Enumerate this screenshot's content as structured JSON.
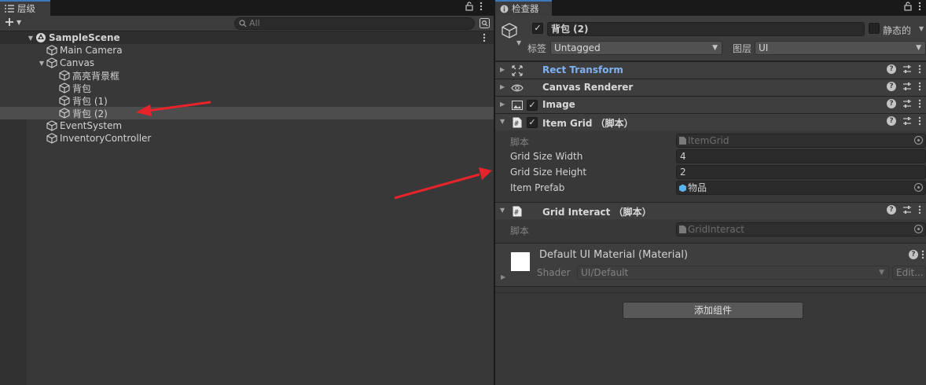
{
  "hierarchy": {
    "tab_label": "层级",
    "search_placeholder": "All",
    "scene": "SampleScene",
    "items": [
      {
        "label": "Main Camera"
      },
      {
        "label": "Canvas"
      },
      {
        "label": "高亮背景框"
      },
      {
        "label": "背包"
      },
      {
        "label": "背包 (1)"
      },
      {
        "label": "背包 (2)"
      },
      {
        "label": "EventSystem"
      },
      {
        "label": "InventoryController"
      }
    ]
  },
  "inspector": {
    "tab_label": "检查器",
    "object_name": "背包 (2)",
    "static_label": "静态的",
    "tag_label": "标签",
    "tag_value": "Untagged",
    "layer_label": "图层",
    "layer_value": "UI",
    "components": [
      {
        "name": "Rect Transform",
        "icon": "rect-transform-icon",
        "color": "#7fb2f2"
      },
      {
        "name": "Canvas Renderer",
        "icon": "eye-icon"
      },
      {
        "name": "Image",
        "icon": "image-icon"
      },
      {
        "name": "Item Grid （脚本）",
        "icon": "script-icon"
      },
      {
        "name": "Grid Interact （脚本）",
        "icon": "script-icon"
      }
    ],
    "item_grid": {
      "script_label": "脚本",
      "script_value": "ItemGrid",
      "width_label": "Grid Size Width",
      "width_value": "4",
      "height_label": "Grid Size Height",
      "height_value": "2",
      "prefab_label": "Item Prefab",
      "prefab_value": "物品"
    },
    "grid_interact": {
      "script_label": "脚本",
      "script_value": "GridInteract"
    },
    "material": {
      "name": "Default UI Material (Material)",
      "shader_label": "Shader",
      "shader_value": "UI/Default",
      "edit_label": "Edit..."
    },
    "add_component_label": "添加组件"
  },
  "colors": {
    "annotation_arrow": "#e8232a",
    "selection": "#4d4d4d",
    "accent_blue": "#7fb2f2"
  }
}
